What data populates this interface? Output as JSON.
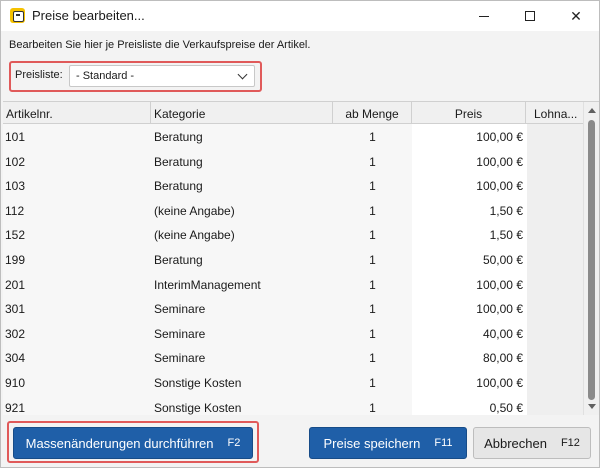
{
  "window": {
    "title": "Preise bearbeiten...",
    "icon": "app-icon"
  },
  "description": "Bearbeiten Sie hier je Preisliste die Verkaufspreise der Artikel.",
  "preisliste": {
    "label": "Preisliste:",
    "selected": "- Standard -"
  },
  "grid": {
    "columns": [
      "Artikelnr.",
      "Kategorie",
      "ab Menge",
      "Preis",
      "Lohna..."
    ],
    "rows": [
      {
        "art": "101",
        "kat": "Beratung",
        "menge": "1",
        "preis": "100,00 €"
      },
      {
        "art": "102",
        "kat": "Beratung",
        "menge": "1",
        "preis": "100,00 €"
      },
      {
        "art": "103",
        "kat": "Beratung",
        "menge": "1",
        "preis": "100,00 €"
      },
      {
        "art": "112",
        "kat": "(keine Angabe)",
        "menge": "1",
        "preis": "1,50 €"
      },
      {
        "art": "152",
        "kat": "(keine Angabe)",
        "menge": "1",
        "preis": "1,50 €"
      },
      {
        "art": "199",
        "kat": "Beratung",
        "menge": "1",
        "preis": "50,00 €"
      },
      {
        "art": "201",
        "kat": "InterimManagement",
        "menge": "1",
        "preis": "100,00 €"
      },
      {
        "art": "301",
        "kat": "Seminare",
        "menge": "1",
        "preis": "100,00 €"
      },
      {
        "art": "302",
        "kat": "Seminare",
        "menge": "1",
        "preis": "40,00 €"
      },
      {
        "art": "304",
        "kat": "Seminare",
        "menge": "1",
        "preis": "80,00 €"
      },
      {
        "art": "910",
        "kat": "Sonstige Kosten",
        "menge": "1",
        "preis": "100,00 €"
      },
      {
        "art": "921",
        "kat": "Sonstige Kosten",
        "menge": "1",
        "preis": "0,50 €"
      }
    ]
  },
  "buttons": {
    "mass_label": "Massenänderungen durchführen",
    "mass_shortcut": "F2",
    "save_label": "Preise speichern",
    "save_shortcut": "F11",
    "cancel_label": "Abbrechen",
    "cancel_shortcut": "F12"
  },
  "colors": {
    "primary": "#1f5fa8",
    "highlight_border": "#e05a5a"
  }
}
